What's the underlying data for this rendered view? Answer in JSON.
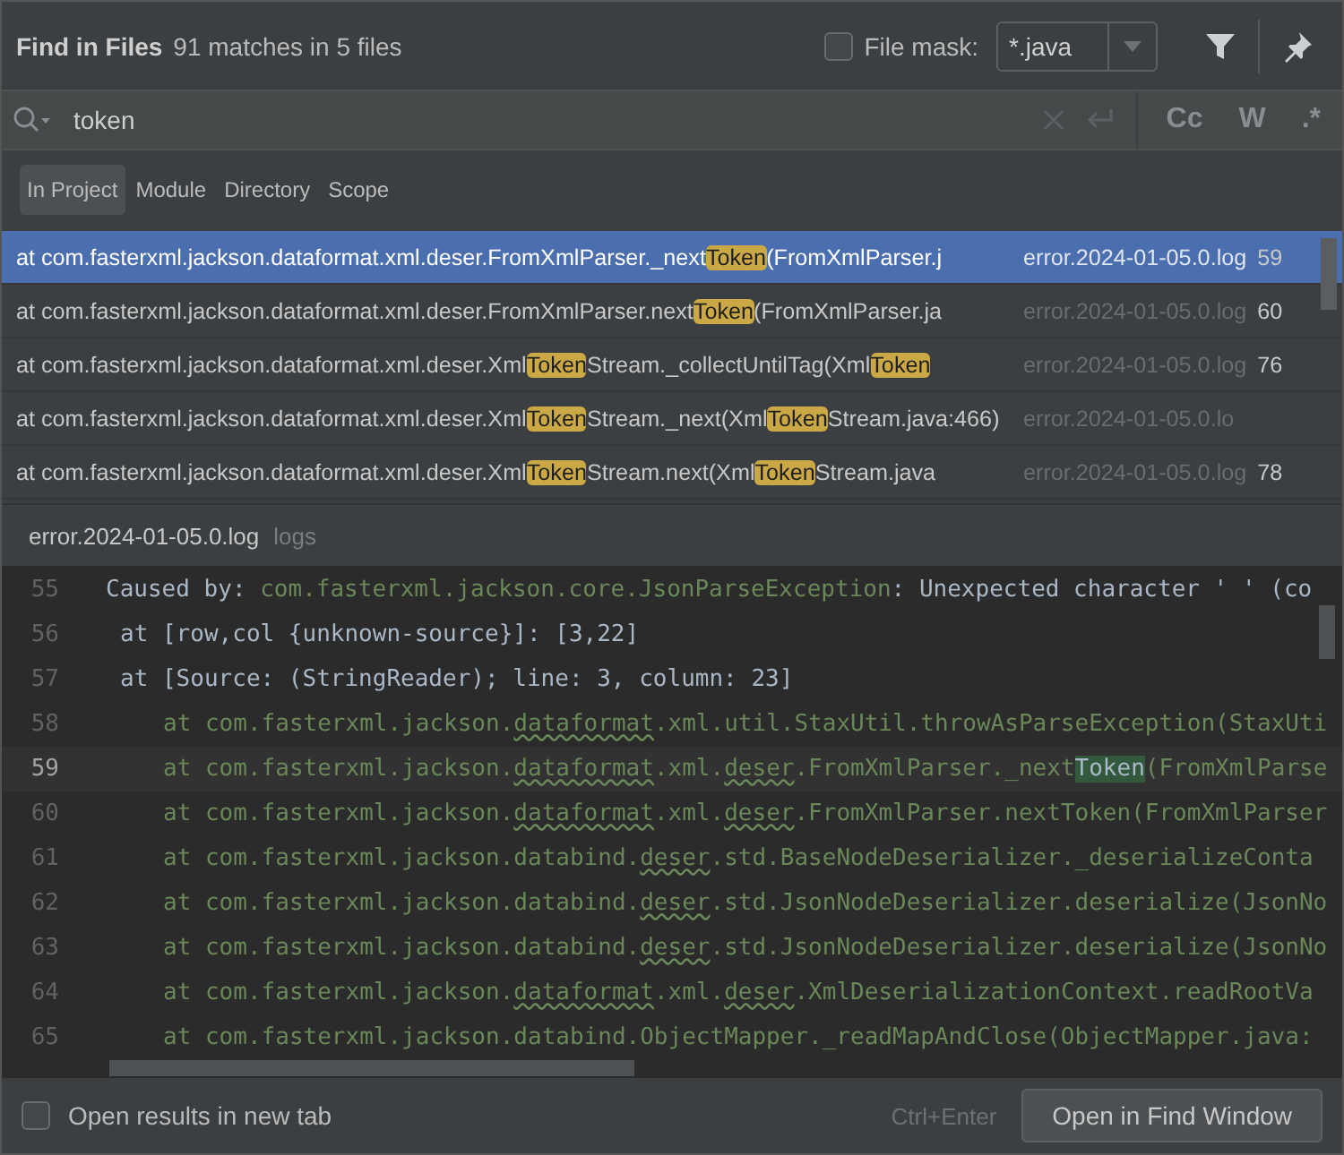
{
  "header": {
    "title": "Find in Files",
    "summary": "91 matches in 5 files",
    "file_mask": {
      "label": "File mask:",
      "checked": false,
      "value": "*.java"
    }
  },
  "search": {
    "value": "token",
    "options": [
      "Cc",
      "W",
      ".*"
    ]
  },
  "scopes": [
    {
      "label": "In Project",
      "selected": true
    },
    {
      "label": "Module",
      "selected": false
    },
    {
      "label": "Directory",
      "selected": false
    },
    {
      "label": "Scope",
      "selected": false
    }
  ],
  "results": [
    {
      "selected": true,
      "parts": [
        {
          "text": "at com.fasterxml.jackson.dataformat.xml.deser.FromXmlParser._next",
          "match": false
        },
        {
          "text": "Token",
          "match": true
        },
        {
          "text": "(FromXmlParser.j",
          "match": false
        }
      ],
      "file": "error.2024-01-05.0.log",
      "line": "59"
    },
    {
      "selected": false,
      "parts": [
        {
          "text": "at com.fasterxml.jackson.dataformat.xml.deser.FromXmlParser.next",
          "match": false
        },
        {
          "text": "Token",
          "match": true
        },
        {
          "text": "(FromXmlParser.ja",
          "match": false
        }
      ],
      "file": "error.2024-01-05.0.log",
      "line": "60"
    },
    {
      "selected": false,
      "parts": [
        {
          "text": "at com.fasterxml.jackson.dataformat.xml.deser.Xml",
          "match": false
        },
        {
          "text": "Token",
          "match": true
        },
        {
          "text": "Stream._collectUntilTag(Xml",
          "match": false
        },
        {
          "text": "Token",
          "match": true
        }
      ],
      "file": "error.2024-01-05.0.log",
      "line": "76"
    },
    {
      "selected": false,
      "parts": [
        {
          "text": "at com.fasterxml.jackson.dataformat.xml.deser.Xml",
          "match": false
        },
        {
          "text": "Token",
          "match": true
        },
        {
          "text": "Stream._next(Xml",
          "match": false
        },
        {
          "text": "Token",
          "match": true
        },
        {
          "text": "Stream.java:466)",
          "match": false
        }
      ],
      "file": "error.2024-01-05.0.lo"
    },
    {
      "selected": false,
      "parts": [
        {
          "text": "at com.fasterxml.jackson.dataformat.xml.deser.Xml",
          "match": false
        },
        {
          "text": "Token",
          "match": true
        },
        {
          "text": "Stream.next(Xml",
          "match": false
        },
        {
          "text": "Token",
          "match": true
        },
        {
          "text": "Stream.java",
          "match": false
        }
      ],
      "file": "error.2024-01-05.0.log",
      "line": "78"
    }
  ],
  "preview": {
    "file": "error.2024-01-05.0.log",
    "folder": "logs"
  },
  "code": [
    {
      "number": "55",
      "kind": "message",
      "current": false,
      "parts": [
        {
          "text": "Caused by: ",
          "kind": "text"
        },
        {
          "text": "com.fasterxml.jackson.core.JsonParseException",
          "kind": "plain"
        },
        {
          "text": ": Unexpected character ' ' (co",
          "kind": "text"
        }
      ]
    },
    {
      "number": "56",
      "kind": "detail",
      "current": false,
      "parts": [
        {
          "text": "at [row,col {unknown-source}]: [3,22]",
          "kind": "text"
        }
      ]
    },
    {
      "number": "57",
      "kind": "detail",
      "current": false,
      "parts": [
        {
          "text": "at [Source: (StringReader); line: 3, column: 23]",
          "kind": "text"
        }
      ]
    },
    {
      "number": "58",
      "kind": "frame",
      "current": false,
      "parts": [
        {
          "text": "at com.fasterxml.jackson.",
          "kind": "plain"
        },
        {
          "text": "dataformat",
          "kind": "warn"
        },
        {
          "text": ".xml.util.StaxUtil.throwAsParseException(StaxUti",
          "kind": "plain"
        }
      ]
    },
    {
      "number": "59",
      "kind": "frame",
      "current": true,
      "parts": [
        {
          "text": "at com.fasterxml.jackson.",
          "kind": "plain"
        },
        {
          "text": "dataformat",
          "kind": "warn"
        },
        {
          "text": ".xml.",
          "kind": "plain"
        },
        {
          "text": "deser",
          "kind": "warn"
        },
        {
          "text": ".FromXmlParser._next",
          "kind": "plain"
        },
        {
          "text": "Token",
          "kind": "match"
        },
        {
          "text": "(FromXmlParse",
          "kind": "plain"
        }
      ]
    },
    {
      "number": "60",
      "kind": "frame",
      "current": false,
      "parts": [
        {
          "text": "at com.fasterxml.jackson.",
          "kind": "plain"
        },
        {
          "text": "dataformat",
          "kind": "warn"
        },
        {
          "text": ".xml.",
          "kind": "plain"
        },
        {
          "text": "deser",
          "kind": "warn"
        },
        {
          "text": ".FromXmlParser.nextToken(FromXmlParser",
          "kind": "plain"
        }
      ]
    },
    {
      "number": "61",
      "kind": "frame",
      "current": false,
      "parts": [
        {
          "text": "at com.fasterxml.jackson.databind.",
          "kind": "plain"
        },
        {
          "text": "deser",
          "kind": "warn"
        },
        {
          "text": ".std.BaseNodeDeserializer._deserializeConta",
          "kind": "plain"
        }
      ]
    },
    {
      "number": "62",
      "kind": "frame",
      "current": false,
      "parts": [
        {
          "text": "at com.fasterxml.jackson.databind.",
          "kind": "plain"
        },
        {
          "text": "deser",
          "kind": "warn"
        },
        {
          "text": ".std.JsonNodeDeserializer.deserialize(JsonNo",
          "kind": "plain"
        }
      ]
    },
    {
      "number": "63",
      "kind": "frame",
      "current": false,
      "parts": [
        {
          "text": "at com.fasterxml.jackson.databind.",
          "kind": "plain"
        },
        {
          "text": "deser",
          "kind": "warn"
        },
        {
          "text": ".std.JsonNodeDeserializer.deserialize(JsonNo",
          "kind": "plain"
        }
      ]
    },
    {
      "number": "64",
      "kind": "frame",
      "current": false,
      "parts": [
        {
          "text": "at com.fasterxml.jackson.",
          "kind": "plain"
        },
        {
          "text": "dataformat",
          "kind": "warn"
        },
        {
          "text": ".xml.",
          "kind": "plain"
        },
        {
          "text": "deser",
          "kind": "warn"
        },
        {
          "text": ".XmlDeserializationContext.readRootVa",
          "kind": "plain"
        }
      ]
    },
    {
      "number": "65",
      "kind": "frame",
      "current": false,
      "parts": [
        {
          "text": "at com.fasterxml.jackson.databind.ObjectMapper._readMapAndClose(ObjectMapper.java:",
          "kind": "plain"
        }
      ]
    }
  ],
  "footer": {
    "new_tab": {
      "label": "Open results in new tab",
      "checked": false
    },
    "shortcut": "Ctrl+Enter",
    "button": "Open in Find Window"
  }
}
